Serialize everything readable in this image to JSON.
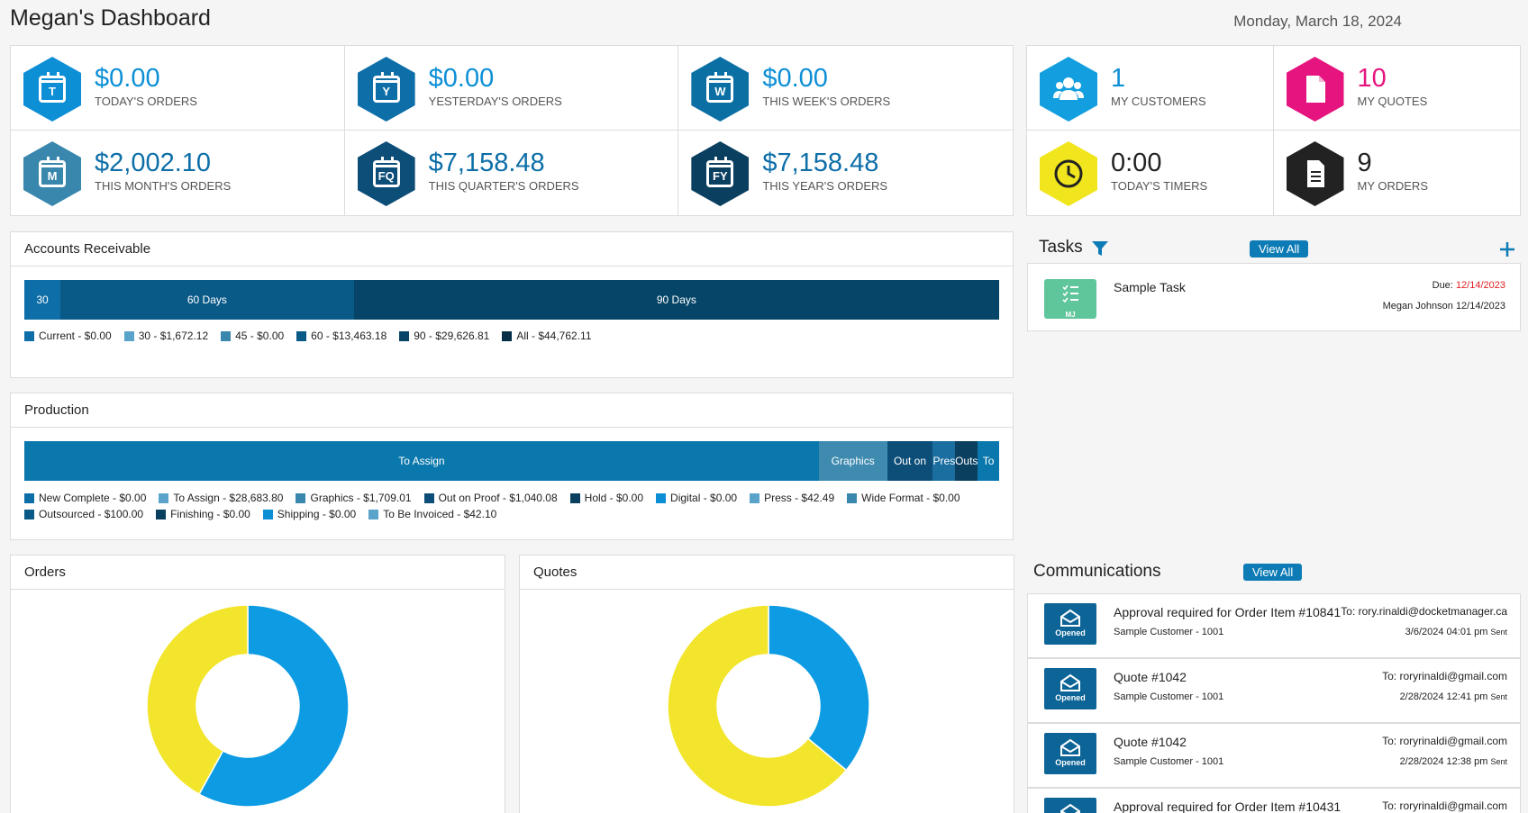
{
  "header": {
    "title": "Megan's Dashboard",
    "date": "Monday, March 18, 2024"
  },
  "order_stats": [
    {
      "value": "$0.00",
      "label": "TODAY'S ORDERS",
      "icon_letter": "T",
      "icon": "calendar-icon",
      "color": "#0d8fd6"
    },
    {
      "value": "$0.00",
      "label": "YESTERDAY'S ORDERS",
      "icon_letter": "Y",
      "icon": "calendar-icon",
      "color": "#0d6ea8"
    },
    {
      "value": "$0.00",
      "label": "THIS WEEK'S ORDERS",
      "icon_letter": "W",
      "icon": "calendar-icon",
      "color": "#0b6fa4"
    },
    {
      "value": "$2,002.10",
      "label": "THIS MONTH'S ORDERS",
      "icon_letter": "M",
      "icon": "calendar-icon",
      "color": "#3a87ad"
    },
    {
      "value": "$7,158.48",
      "label": "THIS QUARTER'S ORDERS",
      "icon_letter": "FQ",
      "icon": "calendar-icon",
      "color": "#0d4e78"
    },
    {
      "value": "$7,158.48",
      "label": "THIS YEAR'S ORDERS",
      "icon_letter": "FY",
      "icon": "calendar-icon",
      "color": "#0a3f60"
    }
  ],
  "side_stats": [
    {
      "value": "1",
      "label": "MY CUSTOMERS",
      "icon": "users-icon",
      "color": "#139ee0",
      "value_color": "#0d8fd6"
    },
    {
      "value": "10",
      "label": "MY QUOTES",
      "icon": "document-icon",
      "color": "#e5147e",
      "value_color": "#e5147e"
    },
    {
      "value": "0:00",
      "label": "TODAY'S TIMERS",
      "icon": "clock-icon",
      "color": "#f1e51d",
      "value_color": "#222222"
    },
    {
      "value": "9",
      "label": "MY ORDERS",
      "icon": "orders-document-icon",
      "color": "#222222",
      "value_color": "#222222"
    }
  ],
  "accounts_receivable": {
    "title": "Accounts Receivable",
    "segments": [
      {
        "label": "30",
        "share": 3.7,
        "color": "#0d6ea8"
      },
      {
        "label": "60 Days",
        "share": 30.1,
        "color": "#0a5a88"
      },
      {
        "label": "90 Days",
        "share": 66.2,
        "color": "#064567"
      }
    ],
    "legend": [
      {
        "label": "Current - $0.00",
        "color": "#0d6ea8"
      },
      {
        "label": "30 - $1,672.12",
        "color": "#5aa4cc"
      },
      {
        "label": "45 - $0.00",
        "color": "#3a87ad"
      },
      {
        "label": "60 - $13,463.18",
        "color": "#0a5a88"
      },
      {
        "label": "90 - $29,626.81",
        "color": "#064567"
      },
      {
        "label": "All - $44,762.11",
        "color": "#052f47"
      }
    ]
  },
  "production": {
    "title": "Production",
    "segments": [
      {
        "label": "To Assign",
        "share": 81.5,
        "color": "#0a78ad"
      },
      {
        "label": "Graphics",
        "share": 7,
        "color": "#3f8bb0"
      },
      {
        "label": "Out on",
        "share": 4.7,
        "color": "#0d4e78"
      },
      {
        "label": "Pres",
        "share": 2.3,
        "color": "#1b6ea0"
      },
      {
        "label": "Outs",
        "share": 2.3,
        "color": "#0a3f60"
      },
      {
        "label": "To",
        "share": 2.2,
        "color": "#0a78ad"
      }
    ],
    "legend": [
      {
        "label": "New Complete - $0.00",
        "color": "#0d6ea8"
      },
      {
        "label": "To Assign - $28,683.80",
        "color": "#5aa4cc"
      },
      {
        "label": "Graphics - $1,709.01",
        "color": "#3a87ad"
      },
      {
        "label": "Out on Proof - $1,040.08",
        "color": "#0d4e78"
      },
      {
        "label": "Hold - $0.00",
        "color": "#0a3f60"
      },
      {
        "label": "Digital - $0.00",
        "color": "#0d8fd6"
      },
      {
        "label": "Press - $42.49",
        "color": "#5aa4cc"
      },
      {
        "label": "Wide Format - $0.00",
        "color": "#3a87ad"
      },
      {
        "label": "Outsourced - $100.00",
        "color": "#0a5a88"
      },
      {
        "label": "Finishing - $0.00",
        "color": "#0a3f60"
      },
      {
        "label": "Shipping - $0.00",
        "color": "#0d8fd6"
      },
      {
        "label": "To Be Invoiced - $42.10",
        "color": "#5aa4cc"
      }
    ]
  },
  "tasks": {
    "title": "Tasks",
    "view_all": "View All",
    "items": [
      {
        "name": "Sample Task",
        "badge": "MJ",
        "due_label": "Due:",
        "due": "12/14/2023",
        "assignee": "Megan Johnson 12/14/2023"
      }
    ]
  },
  "orders_chart": {
    "title": "Orders"
  },
  "quotes_chart": {
    "title": "Quotes"
  },
  "chart_data": [
    {
      "type": "pie",
      "title": "Orders",
      "slices": [
        {
          "value": 58,
          "color": "#0d9be3"
        },
        {
          "value": 42,
          "color": "#f2e52b"
        }
      ]
    },
    {
      "type": "pie",
      "title": "Quotes",
      "slices": [
        {
          "value": 36,
          "color": "#0d9be3"
        },
        {
          "value": 64,
          "color": "#f2e52b"
        }
      ]
    }
  ],
  "communications": {
    "title": "Communications",
    "view_all": "View All",
    "items": [
      {
        "status": "Opened",
        "title": "Approval required for Order Item #10841",
        "sub": "Sample Customer - 1001",
        "to": "To: rory.rinaldi@docketmanager.ca",
        "date": "3/6/2024 04:01 pm",
        "state": "Sent"
      },
      {
        "status": "Opened",
        "title": "Quote #1042",
        "sub": "Sample Customer - 1001",
        "to": "To: roryrinaldi@gmail.com",
        "date": "2/28/2024 12:41 pm",
        "state": "Sent"
      },
      {
        "status": "Opened",
        "title": "Quote #1042",
        "sub": "Sample Customer - 1001",
        "to": "To: roryrinaldi@gmail.com",
        "date": "2/28/2024 12:38 pm",
        "state": "Sent"
      },
      {
        "status": "Opened",
        "title": "Approval required for Order Item #10431",
        "sub": "",
        "to": "To: roryrinaldi@gmail.com",
        "date": "",
        "state": ""
      }
    ]
  }
}
